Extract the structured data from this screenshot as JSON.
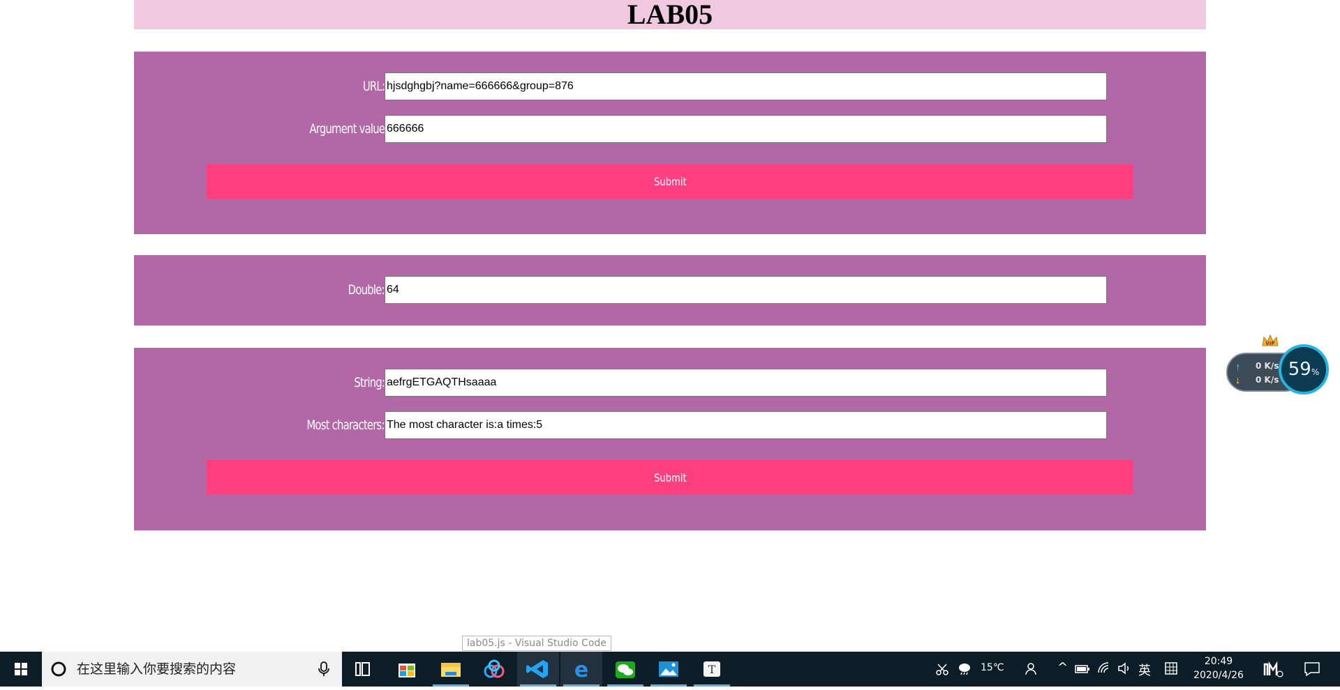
{
  "page": {
    "title": "LAB05",
    "url_form": {
      "url_label": "URL:",
      "url_value": "hjsdghgbj?name=666666&group=876",
      "arg_label": "Argument value",
      "arg_value": "666666",
      "submit_label": "Submit"
    },
    "double_form": {
      "label": "Double:",
      "value": "64"
    },
    "string_form": {
      "string_label": "String:",
      "string_value": "aefrgETGAQTHsaaaa",
      "most_label": "Most characters:",
      "most_value": "The most character is:a times:5",
      "submit_label": "Submit"
    }
  },
  "net_widget": {
    "upload": "0 K/s",
    "download": "0 K/s",
    "percent": "59",
    "percent_unit": "%",
    "badge": "VIP"
  },
  "tooltip": "lab05.js - Visual Studio Code",
  "taskbar": {
    "search_placeholder": "在这里输入你要搜索的内容",
    "weather": "15℃",
    "ime": "英",
    "time": "20:49",
    "date": "2020/4/26"
  },
  "colors": {
    "title_bg": "#f0c8e0",
    "panel_bg": "#b267a6",
    "button_bg": "#ff3f80",
    "taskbar_bg": "#0c1d28"
  }
}
